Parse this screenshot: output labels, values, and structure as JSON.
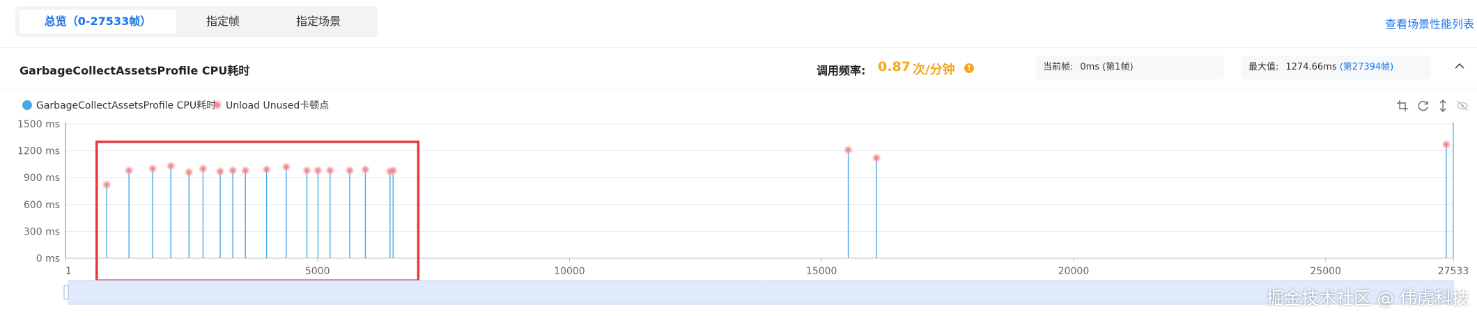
{
  "tabs": [
    {
      "label": "总览（0-27533帧）",
      "active": true
    },
    {
      "label": "指定帧",
      "active": false
    },
    {
      "label": "指定场景",
      "active": false
    }
  ],
  "scene_link": "查看场景性能列表",
  "header": {
    "title": "GarbageCollectAssetsProfile CPU耗时",
    "freq_label": "调用频率:",
    "freq_value": "0.87",
    "freq_unit": "次/分钟",
    "info_icon": "info-icon",
    "current_label": "当前帧:",
    "current_value": "0ms (第1帧)",
    "max_label": "最大值:",
    "max_value": "1274.66ms",
    "max_frame": "(第27394帧)",
    "collapse_icon": "chevron-up-icon"
  },
  "legend": [
    {
      "label": "GarbageCollectAssetsProfile CPU耗时",
      "color": "#4aa8e8"
    },
    {
      "label": "Unload Unused卡顿点",
      "color": "#f28d92"
    }
  ],
  "toolbar_icons": [
    "crop-icon",
    "refresh-icon",
    "vertical-resize-icon",
    "hide-icon"
  ],
  "chart_data": {
    "type": "line",
    "ylim": [
      0,
      1500
    ],
    "yticks": [
      0,
      300,
      600,
      900,
      1200,
      1500
    ],
    "ytick_labels": [
      "0 ms",
      "300 ms",
      "600 ms",
      "900 ms",
      "1200 ms",
      "1500 ms"
    ],
    "xlim": [
      1,
      27533
    ],
    "xticks": [
      1,
      5000,
      10000,
      15000,
      20000,
      25000,
      27533
    ],
    "xtick_labels": [
      "1",
      "5000",
      "10000",
      "15000",
      "20000",
      "25000",
      "27533"
    ],
    "series": [
      {
        "name": "GarbageCollectAssetsProfile CPU耗时",
        "color": "#4aa8e8",
        "spikes": [
          {
            "x": 820,
            "y": 820
          },
          {
            "x": 1260,
            "y": 980
          },
          {
            "x": 1730,
            "y": 1000
          },
          {
            "x": 2090,
            "y": 1030
          },
          {
            "x": 2450,
            "y": 960
          },
          {
            "x": 2730,
            "y": 1000
          },
          {
            "x": 3070,
            "y": 970
          },
          {
            "x": 3320,
            "y": 980
          },
          {
            "x": 3570,
            "y": 980
          },
          {
            "x": 3990,
            "y": 990
          },
          {
            "x": 4380,
            "y": 1020
          },
          {
            "x": 4790,
            "y": 980
          },
          {
            "x": 5010,
            "y": 980
          },
          {
            "x": 5250,
            "y": 980
          },
          {
            "x": 5640,
            "y": 980
          },
          {
            "x": 5950,
            "y": 990
          },
          {
            "x": 6440,
            "y": 970
          },
          {
            "x": 6500,
            "y": 980
          },
          {
            "x": 15530,
            "y": 1210
          },
          {
            "x": 16090,
            "y": 1120
          },
          {
            "x": 27394,
            "y": 1270
          }
        ]
      }
    ],
    "highlight_box": {
      "x_range": [
        620,
        7000
      ],
      "y_range": [
        -250,
        1300
      ],
      "color": "#e8383d"
    }
  },
  "watermark": "掘金技术社区 @ 伟虎科技"
}
